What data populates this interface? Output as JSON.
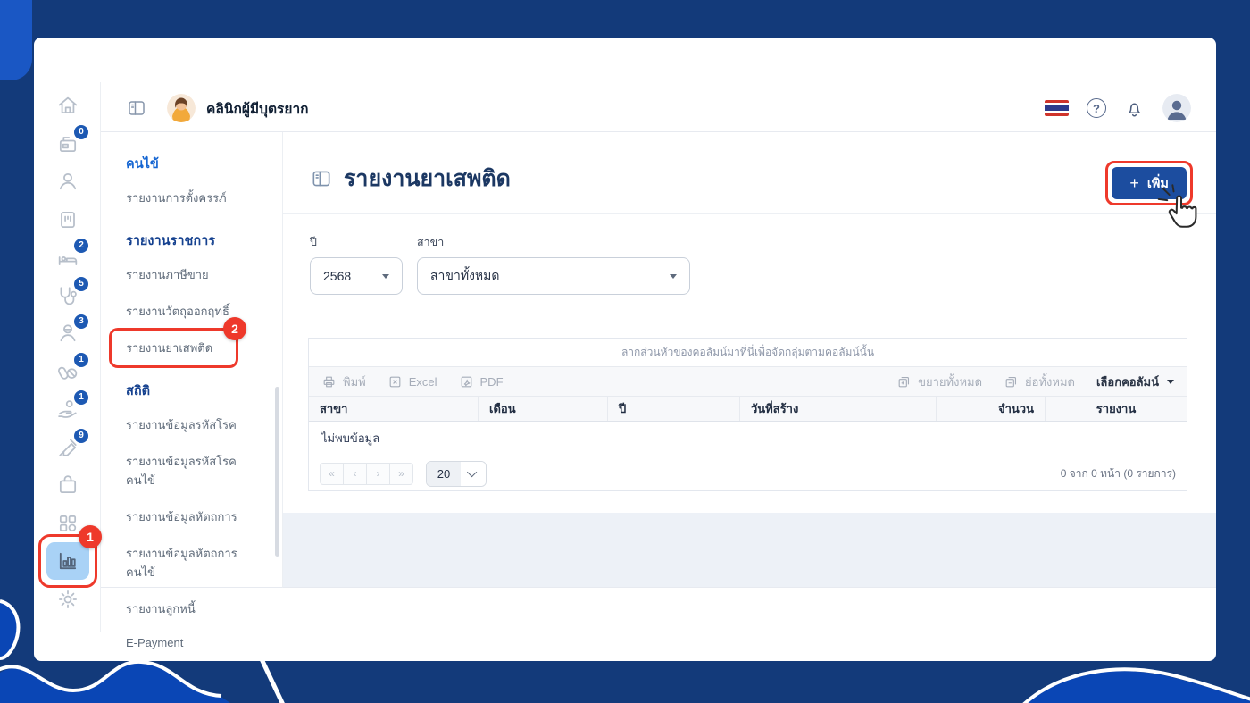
{
  "topbar": {
    "title": "คลินิกผู้มีบุตรยาก",
    "help_glyph": "?"
  },
  "rail": {
    "items": [
      {
        "name": "home",
        "badge": null
      },
      {
        "name": "queue",
        "badge": "0"
      },
      {
        "name": "patient",
        "badge": null
      },
      {
        "name": "card-reader",
        "badge": null
      },
      {
        "name": "bed",
        "badge": "2"
      },
      {
        "name": "stethoscope",
        "badge": "5"
      },
      {
        "name": "doctor",
        "badge": "3"
      },
      {
        "name": "pills",
        "badge": "1"
      },
      {
        "name": "payment-hand",
        "badge": "1"
      },
      {
        "name": "syringe",
        "badge": "9"
      },
      {
        "name": "package",
        "badge": null
      },
      {
        "name": "apps",
        "badge": null
      },
      {
        "name": "report-chart",
        "badge": null
      },
      {
        "name": "settings",
        "badge": null
      }
    ]
  },
  "sidebar": {
    "sections": [
      {
        "header": "คนไข้",
        "items": [
          "รายงานการตั้งครรภ์"
        ]
      },
      {
        "header": "รายงานราชการ",
        "items": [
          "รายงานภาษีขาย",
          "รายงานวัตถุออกฤทธิ์",
          "รายงานยาเสพติด"
        ]
      },
      {
        "header": "สถิติ",
        "items": [
          "รายงานข้อมูลรหัสโรค",
          "รายงานข้อมูลรหัสโรคคนไข้",
          "รายงานข้อมูลหัตถการ",
          "รายงานข้อมูลหัตถการคนไข้",
          "รายงานลูกหนี้",
          "E-Payment"
        ]
      }
    ]
  },
  "page": {
    "title": "รายงานยาเสพติด",
    "add_plus": "+",
    "add_label": "เพิ่ม"
  },
  "filters": {
    "year": {
      "label": "ปี",
      "value": "2568"
    },
    "branch": {
      "label": "สาขา",
      "value": "สาขาทั้งหมด"
    }
  },
  "table": {
    "drag_hint": "ลากส่วนหัวของคอลัมน์มาที่นี่เพื่อจัดกลุ่มตามคอลัมน์นั้น",
    "toolbar": {
      "print": "พิมพ์",
      "excel": "Excel",
      "pdf": "PDF",
      "expand_all": "ขยายทั้งหมด",
      "collapse_all": "ย่อทั้งหมด",
      "choose_columns": "เลือกคอลัมน์"
    },
    "columns": [
      "สาขา",
      "เดือน",
      "ปี",
      "วันที่สร้าง",
      "จำนวน",
      "รายงาน"
    ],
    "empty_text": "ไม่พบข้อมูล",
    "pagination": {
      "buttons": [
        "«",
        "‹",
        "›",
        "»"
      ],
      "page_size": "20",
      "summary": "0 จาก 0 หน้า (0 รายการ)"
    }
  },
  "annotations": {
    "step1": "1",
    "step2": "2"
  },
  "colors": {
    "accent_red": "#EE392B",
    "primary_blue": "#1C4D9F",
    "badge_blue": "#1D59B3",
    "background_navy": "#133A7A",
    "blob_blue": "#0A46B5"
  }
}
